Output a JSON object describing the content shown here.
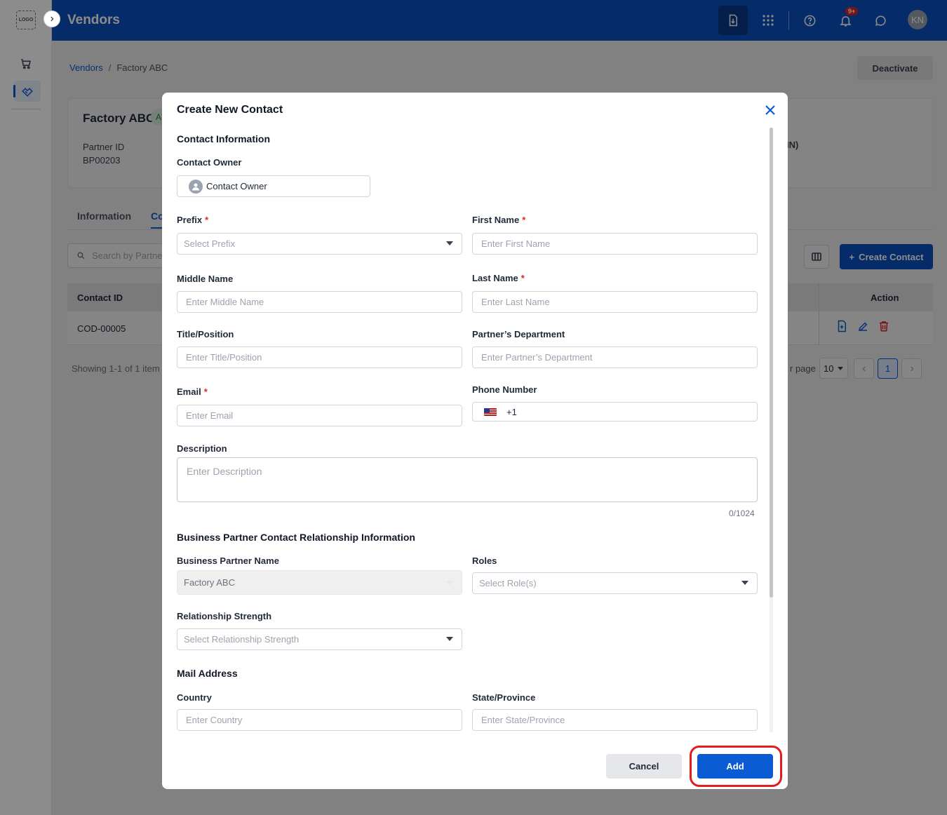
{
  "app": {
    "logo_text": "LOGO",
    "title": "Vendors",
    "notification_badge": "9+",
    "user_initials": "KN"
  },
  "breadcrumb": {
    "root": "Vendors",
    "separator": "/",
    "current": "Factory ABC"
  },
  "deactivate_label": "Deactivate",
  "summary": {
    "name": "Factory ABC",
    "status_letter": "A",
    "partner_id_label": "Partner ID",
    "partner_id": "BP00203",
    "right_label_fragment": "IN)"
  },
  "tabs": [
    {
      "label": "Information"
    },
    {
      "label": "Co"
    }
  ],
  "contacts": {
    "search_placeholder": "Search by Partner",
    "create_label": "Create Contact",
    "columns": {
      "contact_id": "Contact ID",
      "action": "Action"
    },
    "rows": [
      {
        "contact_id": "COD-00005"
      }
    ],
    "showing": "Showing 1-1 of 1 item",
    "per_page_label": "r page",
    "per_page_value": "10",
    "current_page": "1"
  },
  "modal": {
    "title": "Create New Contact",
    "sections": {
      "contact_info": "Contact Information",
      "relationship": "Business Partner Contact Relationship Information",
      "mail": "Mail Address"
    },
    "fields": {
      "contact_owner": {
        "label": "Contact Owner",
        "value": "Contact Owner"
      },
      "prefix": {
        "label": "Prefix",
        "placeholder": "Select Prefix"
      },
      "first_name": {
        "label": "First Name",
        "placeholder": "Enter First Name"
      },
      "middle_name": {
        "label": "Middle Name",
        "placeholder": "Enter Middle Name"
      },
      "last_name": {
        "label": "Last Name",
        "placeholder": "Enter Last Name"
      },
      "title_position": {
        "label": "Title/Position",
        "placeholder": "Enter Title/Position"
      },
      "department": {
        "label": "Partner’s Department",
        "placeholder": "Enter Partner’s Department"
      },
      "email": {
        "label": "Email",
        "placeholder": "Enter Email"
      },
      "phone": {
        "label": "Phone Number",
        "code": "+1"
      },
      "description": {
        "label": "Description",
        "placeholder": "Enter Description",
        "counter": "0/1024"
      },
      "bp_name": {
        "label": "Business Partner Name",
        "value": "Factory ABC"
      },
      "roles": {
        "label": "Roles",
        "placeholder": "Select Role(s)"
      },
      "relationship_strength": {
        "label": "Relationship Strength",
        "placeholder": "Select Relationship Strength"
      },
      "country": {
        "label": "Country",
        "placeholder": "Enter Country"
      },
      "state": {
        "label": "State/Province",
        "placeholder": "Enter State/Province"
      }
    },
    "required_marker": "*",
    "cancel_label": "Cancel",
    "add_label": "Add"
  },
  "colors": {
    "brand": "#0a4fbf",
    "primary_button": "#0b5bd3",
    "required": "#dc2626",
    "highlight_outline": "#e11d1d"
  }
}
